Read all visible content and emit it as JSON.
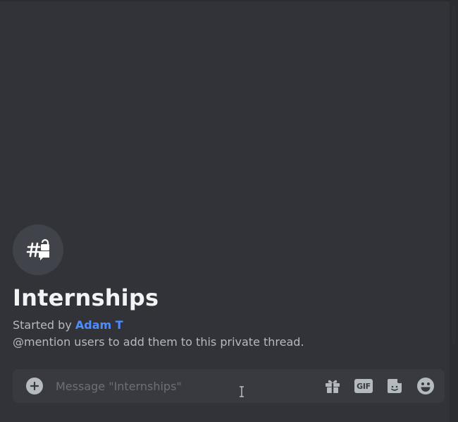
{
  "thread": {
    "title": "Internships",
    "started_prefix": "Started by",
    "author": "Adam T",
    "description": "@mention users to add them to this private thread.",
    "icon": "private-thread-icon"
  },
  "composer": {
    "placeholder": "Message \"Internships\"",
    "value": "",
    "add_icon": "plus-circle-icon",
    "gif_label": "GIF",
    "tools": [
      "gift-icon",
      "gif-icon",
      "sticker-icon",
      "emoji-icon"
    ]
  },
  "colors": {
    "background": "#313338",
    "composer": "#383a40",
    "title": "#f2f3f5",
    "muted_text": "#b5bac1",
    "author_link": "#4e8dfc"
  }
}
